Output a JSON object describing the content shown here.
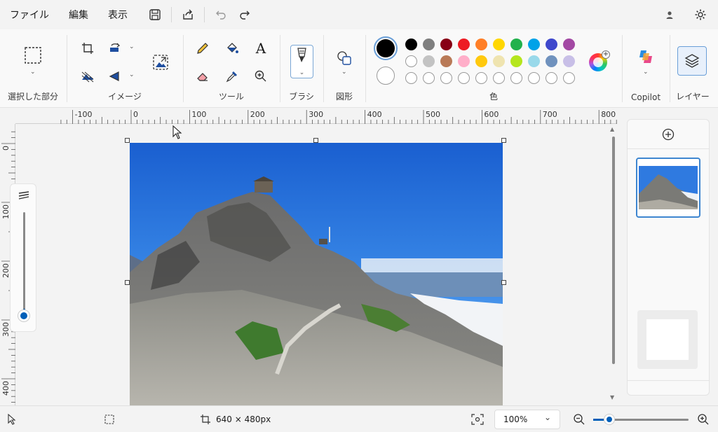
{
  "menu": {
    "items": [
      "ファイル",
      "編集",
      "表示"
    ]
  },
  "toolbar_icons": [
    "save-icon",
    "share-icon",
    "undo-icon",
    "redo-icon"
  ],
  "ribbon": {
    "groups": {
      "selection": "選択した部分",
      "image": "イメージ",
      "tools": "ツール",
      "brush": "ブラシ",
      "shapes": "図形",
      "colors": "色",
      "copilot": "Copilot",
      "layers": "レイヤー"
    },
    "text_tool": "A"
  },
  "palette": {
    "primary": "#000000",
    "secondary": "#ffffff",
    "row1": [
      "#000000",
      "#7f7f7f",
      "#880015",
      "#ed1c24",
      "#ff7f27",
      "#ffd700",
      "#22b14c",
      "#00a2e8",
      "#3f48cc",
      "#a349a4"
    ],
    "row2": [
      "#ffffff",
      "#c3c3c3",
      "#b97a57",
      "#ffaec9",
      "#ffc90e",
      "#efe4b0",
      "#b5e61d",
      "#99d9ea",
      "#7092be",
      "#c8bfe7"
    ],
    "row3_empty_count": 10
  },
  "ruler": {
    "h_labels": [
      "-100",
      "0",
      "100",
      "200",
      "300",
      "400",
      "500",
      "600",
      "700",
      "800"
    ],
    "v_labels": [
      "0",
      "100",
      "200",
      "300",
      "400"
    ]
  },
  "status": {
    "dimensions": "640 × 480px",
    "zoom": "100%"
  },
  "colors": {
    "accent": "#005fb8"
  }
}
